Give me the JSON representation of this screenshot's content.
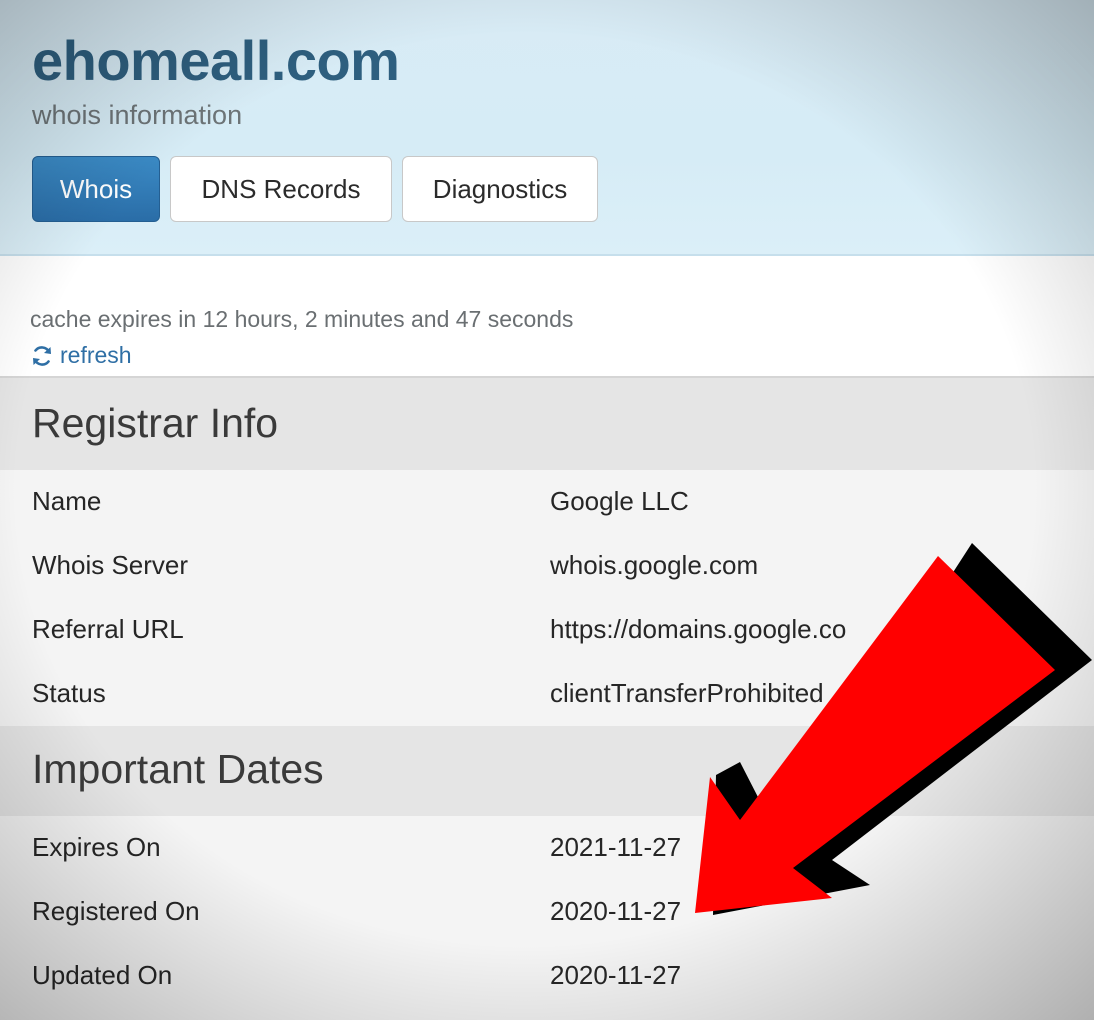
{
  "header": {
    "domain": "ehomeall.com",
    "subtitle": "whois information",
    "tabs": [
      {
        "label": "Whois",
        "active": true
      },
      {
        "label": "DNS Records",
        "active": false
      },
      {
        "label": "Diagnostics",
        "active": false
      }
    ]
  },
  "cache": {
    "text": "cache expires in 12 hours, 2 minutes and 47 seconds",
    "refresh_label": "refresh",
    "refresh_icon": "refresh-icon"
  },
  "registrar": {
    "title": "Registrar Info",
    "rows": [
      {
        "label": "Name",
        "value": "Google LLC"
      },
      {
        "label": "Whois Server",
        "value": "whois.google.com"
      },
      {
        "label": "Referral URL",
        "value": "https://domains.google.co"
      },
      {
        "label": "Status",
        "value": "clientTransferProhibited"
      }
    ]
  },
  "dates": {
    "title": "Important Dates",
    "rows": [
      {
        "label": "Expires On",
        "value": "2021-11-27"
      },
      {
        "label": "Registered On",
        "value": "2020-11-27"
      },
      {
        "label": "Updated On",
        "value": "2020-11-27"
      }
    ]
  },
  "annotation": {
    "arrow_icon": "red-arrow-icon",
    "arrow_color": "#ff0000",
    "shadow_color": "#000000"
  },
  "colors": {
    "accent": "#2a6da7",
    "title": "#2e5f7f",
    "link": "#2f6fa5"
  }
}
